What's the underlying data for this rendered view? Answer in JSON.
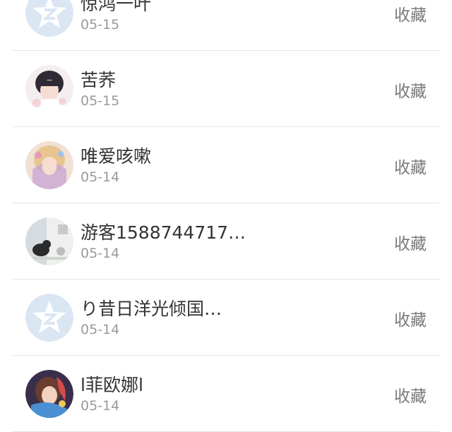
{
  "items": [
    {
      "name": "惊鸿一叶",
      "date": "05-15",
      "action": "收藏",
      "avatar": "default-qq-avatar"
    },
    {
      "name": "苦荞",
      "date": "05-15",
      "action": "收藏",
      "avatar": "photo-avatar"
    },
    {
      "name": "唯爱咳嗽",
      "date": "05-14",
      "action": "收藏",
      "avatar": "photo-avatar"
    },
    {
      "name": "游客1588744717…",
      "date": "05-14",
      "action": "收藏",
      "avatar": "photo-avatar"
    },
    {
      "name": "り昔日洋光倾国…",
      "date": "05-14",
      "action": "收藏",
      "avatar": "default-qq-avatar"
    },
    {
      "name": "l菲欧娜l",
      "date": "05-14",
      "action": "收藏",
      "avatar": "photo-avatar"
    }
  ],
  "colors": {
    "default_avatar_bg": "#dbe6f3",
    "default_avatar_star": "#ffffff",
    "divider": "#e4e4e4"
  }
}
